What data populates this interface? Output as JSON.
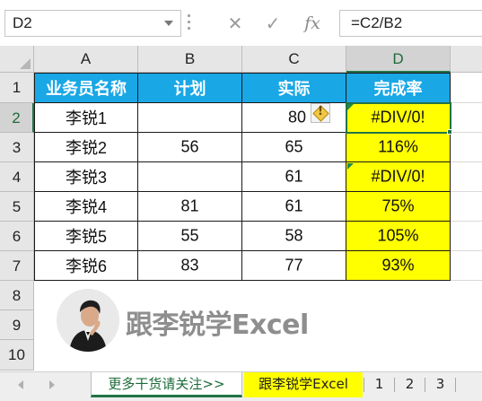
{
  "formula_bar": {
    "name_box": "D2",
    "cancel_glyph": "✕",
    "enter_glyph": "✓",
    "fx_label": "fx",
    "formula": "=C2/B2"
  },
  "columns": [
    "A",
    "B",
    "C",
    "D"
  ],
  "rows": [
    "1",
    "2",
    "3",
    "4",
    "5",
    "6",
    "7",
    "8",
    "9",
    "10"
  ],
  "table": {
    "headers": [
      "业务员名称",
      "计划",
      "实际",
      "完成率"
    ],
    "data": [
      [
        "李锐1",
        "",
        "80",
        "#DIV/0!"
      ],
      [
        "李锐2",
        "56",
        "65",
        "116%"
      ],
      [
        "李锐3",
        "",
        "61",
        "#DIV/0!"
      ],
      [
        "李锐4",
        "81",
        "61",
        "75%"
      ],
      [
        "李锐5",
        "55",
        "58",
        "105%"
      ],
      [
        "李锐6",
        "83",
        "77",
        "93%"
      ]
    ]
  },
  "selected_cell": "D2",
  "warning_glyph": "!",
  "brand": {
    "text": "跟李锐学Excel",
    "avatar_icon": "person-avatar-icon"
  },
  "sheet_tabs": [
    {
      "label": "更多干货请关注>>"
    },
    {
      "label": "跟李锐学Excel"
    },
    {
      "label": "1"
    },
    {
      "label": "2"
    },
    {
      "label": "3"
    }
  ],
  "colors": {
    "header_fill": "#19a7e6",
    "result_fill": "#ffff00",
    "selection": "#217346"
  }
}
